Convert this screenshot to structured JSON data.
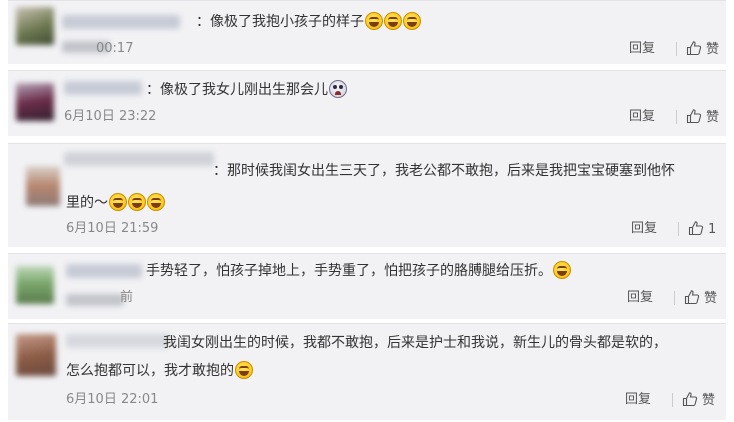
{
  "comments": [
    {
      "text_before": "：像极了我抱小孩子的样子",
      "emojis": [
        "laugh-cry-icon",
        "laugh-cry-icon",
        "laugh-cry-icon"
      ],
      "date": "00:17",
      "reply_label": "回复",
      "like_label": "赞"
    },
    {
      "text_before": "：像极了我女儿刚出生那会儿",
      "emojis": [
        "crying-face-icon"
      ],
      "date": "6月10日 23:22",
      "reply_label": "回复",
      "like_label": "赞"
    },
    {
      "text_line1": "：那时候我闺女出生三天了，我老公都不敢抱，后来是我把宝宝硬塞到他怀",
      "text_line2": "里的～",
      "emojis": [
        "laugh-cry-icon",
        "laugh-cry-icon",
        "laugh-cry-icon"
      ],
      "date": "6月10日 21:59",
      "reply_label": "回复",
      "like_label": "1"
    },
    {
      "text_before": "手势轻了，怕孩子掉地上，手势重了，怕把孩子的胳膊腿给压折。",
      "emojis": [
        "laugh-cry-icon"
      ],
      "date": "前",
      "reply_label": "回复",
      "like_label": "赞"
    },
    {
      "text_line1": "我闺女刚出生的时候，我都不敢抱，后来是护士和我说，新生儿的骨头都是软的，",
      "text_line2": "怎么抱都可以，我才敢抱的",
      "emojis": [
        "laugh-cry-icon"
      ],
      "date": "6月10日 22:01",
      "reply_label": "回复",
      "like_label": "赞"
    }
  ],
  "colors": {
    "card_bg": "#f2f2f5",
    "text": "#333333",
    "muted": "#888888"
  }
}
